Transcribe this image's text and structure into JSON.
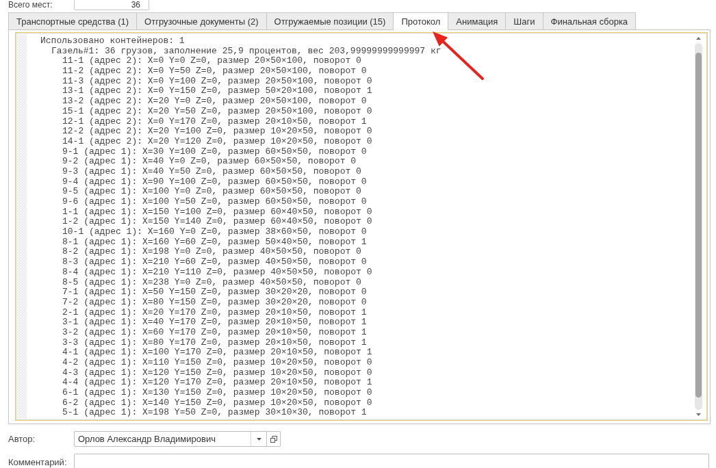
{
  "summary": {
    "label": "Всего мест:",
    "value": "36"
  },
  "tabs": [
    {
      "label": "Транспортные средства (1)",
      "selected": false
    },
    {
      "label": "Отгрузочные документы (2)",
      "selected": false
    },
    {
      "label": "Отгружаемые позиции (15)",
      "selected": false
    },
    {
      "label": "Протокол",
      "selected": true
    },
    {
      "label": "Анимация",
      "selected": false
    },
    {
      "label": "Шаги",
      "selected": false
    },
    {
      "label": "Финальная сборка",
      "selected": false
    }
  ],
  "protocol": {
    "lines": [
      {
        "text": "Использовано контейнеров: 1",
        "children": [
          {
            "text": "Газель#1: 36 грузов, заполнение 25,9 процентов, вес 203,99999999999997 кг",
            "children": [
              {
                "text": "11-1 (адрес 2): X=0 Y=0 Z=0, размер 20×50×100, поворот 0"
              },
              {
                "text": "11-2 (адрес 2): X=0 Y=50 Z=0, размер 20×50×100, поворот 0"
              },
              {
                "text": "11-3 (адрес 2): X=0 Y=100 Z=0, размер 20×50×100, поворот 0"
              },
              {
                "text": "13-1 (адрес 2): X=0 Y=150 Z=0, размер 50×20×100, поворот 1"
              },
              {
                "text": "13-2 (адрес 2): X=20 Y=0 Z=0, размер 20×50×100, поворот 0"
              },
              {
                "text": "15-1 (адрес 2): X=20 Y=50 Z=0, размер 20×50×100, поворот 0"
              },
              {
                "text": "12-1 (адрес 2): X=0 Y=170 Z=0, размер 20×10×50, поворот 1"
              },
              {
                "text": "12-2 (адрес 2): X=20 Y=100 Z=0, размер 10×20×50, поворот 0"
              },
              {
                "text": "14-1 (адрес 2): X=20 Y=120 Z=0, размер 10×20×50, поворот 0"
              },
              {
                "text": "9-1 (адрес 1): X=30 Y=100 Z=0, размер 60×50×50, поворот 0"
              },
              {
                "text": "9-2 (адрес 1): X=40 Y=0 Z=0, размер 60×50×50, поворот 0"
              },
              {
                "text": "9-3 (адрес 1): X=40 Y=50 Z=0, размер 60×50×50, поворот 0"
              },
              {
                "text": "9-4 (адрес 1): X=90 Y=100 Z=0, размер 60×50×50, поворот 0"
              },
              {
                "text": "9-5 (адрес 1): X=100 Y=0 Z=0, размер 60×50×50, поворот 0"
              },
              {
                "text": "9-6 (адрес 1): X=100 Y=50 Z=0, размер 60×50×50, поворот 0"
              },
              {
                "text": "1-1 (адрес 1): X=150 Y=100 Z=0, размер 60×40×50, поворот 0"
              },
              {
                "text": "1-2 (адрес 1): X=150 Y=140 Z=0, размер 60×40×50, поворот 0"
              },
              {
                "text": "10-1 (адрес 1): X=160 Y=0 Z=0, размер 38×60×50, поворот 0"
              },
              {
                "text": "8-1 (адрес 1): X=160 Y=60 Z=0, размер 50×40×50, поворот 1"
              },
              {
                "text": "8-2 (адрес 1): X=198 Y=0 Z=0, размер 40×50×50, поворот 0"
              },
              {
                "text": "8-3 (адрес 1): X=210 Y=60 Z=0, размер 40×50×50, поворот 0"
              },
              {
                "text": "8-4 (адрес 1): X=210 Y=110 Z=0, размер 40×50×50, поворот 0"
              },
              {
                "text": "8-5 (адрес 1): X=238 Y=0 Z=0, размер 40×50×50, поворот 0"
              },
              {
                "text": "7-1 (адрес 1): X=50 Y=150 Z=0, размер 30×20×20, поворот 0"
              },
              {
                "text": "7-2 (адрес 1): X=80 Y=150 Z=0, размер 30×20×20, поворот 0"
              },
              {
                "text": "2-1 (адрес 1): X=20 Y=170 Z=0, размер 20×10×50, поворот 1"
              },
              {
                "text": "3-1 (адрес 1): X=40 Y=170 Z=0, размер 20×10×50, поворот 1"
              },
              {
                "text": "3-2 (адрес 1): X=60 Y=170 Z=0, размер 20×10×50, поворот 1"
              },
              {
                "text": "3-3 (адрес 1): X=80 Y=170 Z=0, размер 20×10×50, поворот 1"
              },
              {
                "text": "4-1 (адрес 1): X=100 Y=170 Z=0, размер 20×10×50, поворот 1"
              },
              {
                "text": "4-2 (адрес 1): X=110 Y=150 Z=0, размер 10×20×50, поворот 0"
              },
              {
                "text": "4-3 (адрес 1): X=120 Y=150 Z=0, размер 10×20×50, поворот 0"
              },
              {
                "text": "4-4 (адрес 1): X=120 Y=170 Z=0, размер 20×10×50, поворот 1"
              },
              {
                "text": "6-1 (адрес 1): X=130 Y=150 Z=0, размер 10×20×50, поворот 0"
              },
              {
                "text": "6-2 (адрес 1): X=140 Y=150 Z=0, размер 10×20×50, поворот 0"
              },
              {
                "text": "5-1 (адрес 1): X=198 Y=50 Z=0, размер 30×10×30, поворот 1"
              }
            ]
          }
        ]
      }
    ]
  },
  "author": {
    "label": "Автор:",
    "value": "Орлов Александр Владимирович"
  },
  "comment": {
    "label": "Комментарий:"
  }
}
